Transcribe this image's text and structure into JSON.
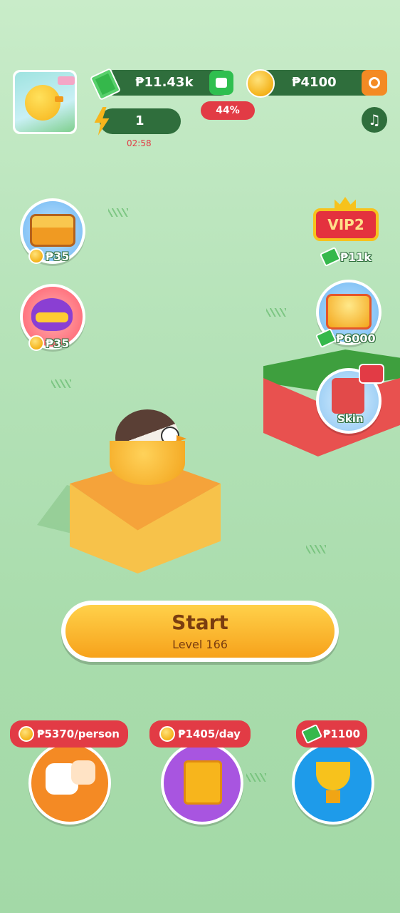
{
  "header": {
    "cash_balance": "₱11.43k",
    "coin_balance": "₱4100",
    "energy_count": "1",
    "energy_timer": "02:58",
    "progress_percent": "44%"
  },
  "left_rewards": [
    {
      "name": "treasure-chest",
      "price": "₱35"
    },
    {
      "name": "mystery-mask",
      "price": "₱35"
    }
  ],
  "right_rewards": {
    "vip": {
      "badge": "VIP2",
      "price": "₱11k"
    },
    "gold_chest": {
      "price": "₱6000"
    },
    "skin": {
      "label": "Skin"
    }
  },
  "start_button": {
    "label": "Start",
    "level": "Level 166"
  },
  "bottom": [
    {
      "tag": "₱5370/person",
      "tag_icon": "coin",
      "icon": "invite-friends-icon",
      "color": "#f48a24"
    },
    {
      "tag": "₱1405/day",
      "tag_icon": "coin",
      "icon": "notebook-icon",
      "color": "#a855e0"
    },
    {
      "tag": "₱1100",
      "tag_icon": "cash",
      "icon": "trophy-icon",
      "color": "#1e9bea"
    }
  ],
  "colors": {
    "accent_red": "#e23b45",
    "dark_green": "#2f6e3c",
    "start_orange": "#f7a21b"
  }
}
